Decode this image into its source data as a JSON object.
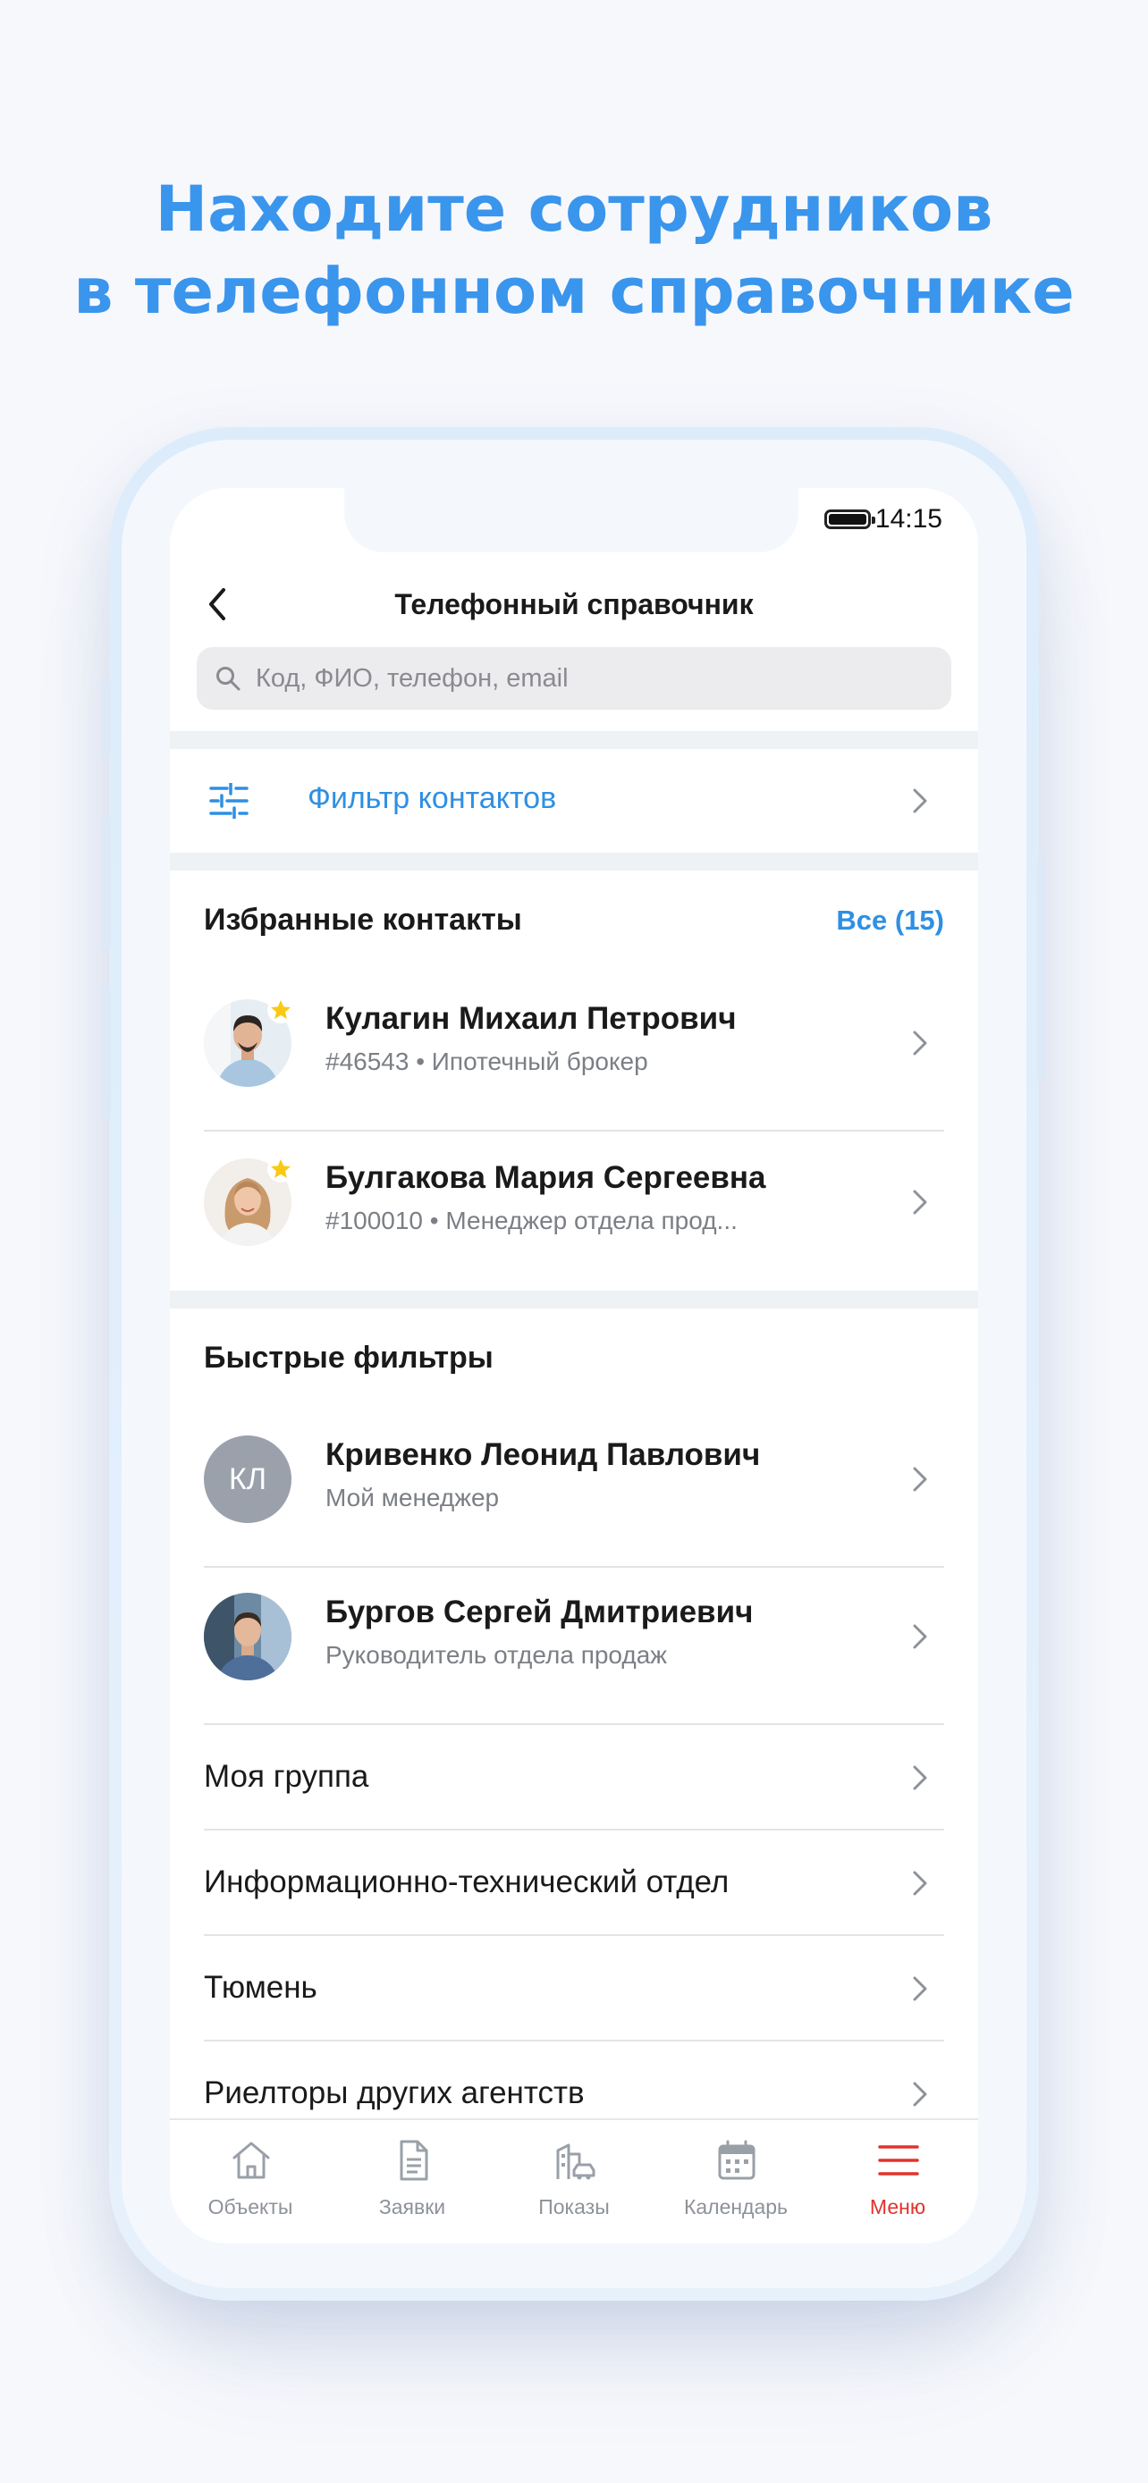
{
  "headline": {
    "line1": "Находите сотрудников",
    "line2": "в телефонном справочнике"
  },
  "status": {
    "time": "14:15"
  },
  "nav": {
    "title": "Телефонный справочник"
  },
  "search": {
    "placeholder": "Код, ФИО, телефон, email"
  },
  "filter": {
    "label": "Фильтр контактов"
  },
  "favorites": {
    "title": "Избранные контакты",
    "all_link": "Все (15)",
    "items": [
      {
        "name": "Кулагин Михаил Петрович",
        "subtitle": "#46543 • Ипотечный брокер"
      },
      {
        "name": "Булгакова Мария Сергеевна",
        "subtitle": "#100010 • Менеджер отдела прод..."
      }
    ]
  },
  "quick_filters": {
    "title": "Быстрые фильтры",
    "contacts": [
      {
        "initials": "КЛ",
        "name": "Кривенко Леонид Павлович",
        "subtitle": "Мой менеджер"
      },
      {
        "name": "Бургов Сергей Дмитриевич",
        "subtitle": "Руководитель отдела продаж"
      }
    ],
    "groups": [
      "Моя группа",
      "Информационно-технический отдел",
      "Тюмень",
      "Риелторы других агентств"
    ]
  },
  "tabs": [
    {
      "label": "Объекты",
      "icon": "house-icon",
      "active": false
    },
    {
      "label": "Заявки",
      "icon": "document-icon",
      "active": false
    },
    {
      "label": "Показы",
      "icon": "buildings-car-icon",
      "active": false
    },
    {
      "label": "Календарь",
      "icon": "calendar-icon",
      "active": false
    },
    {
      "label": "Меню",
      "icon": "menu-icon",
      "active": true
    }
  ],
  "colors": {
    "accent": "#2f8fe3",
    "headline": "#3a95ec",
    "active_tab": "#e2332b",
    "star": "#f9c915"
  }
}
